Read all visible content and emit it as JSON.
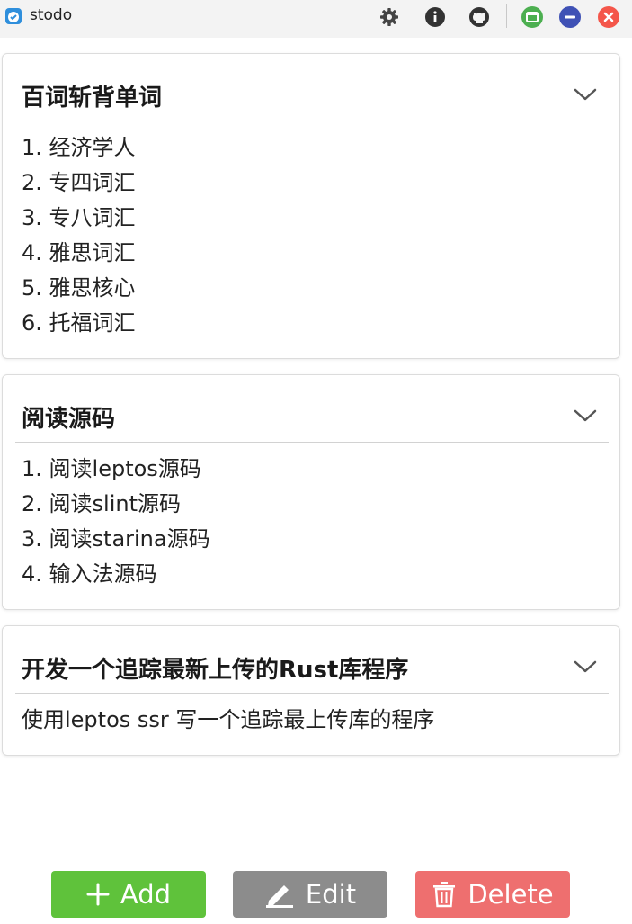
{
  "window": {
    "title": "stodo",
    "controls": [
      "settings-icon",
      "info-icon",
      "github-icon",
      "maximize-icon",
      "minimize-icon",
      "close-icon"
    ],
    "colors": {
      "maximize": "#4caf50",
      "minimize": "#3f51b5",
      "close": "#f4564a"
    }
  },
  "cards": [
    {
      "title": "百词斩背单词",
      "lines": [
        "1. 经济学人",
        "2. 专四词汇",
        "3. 专八词汇",
        "4. 雅思词汇",
        "5. 雅思核心",
        "6. 托福词汇"
      ]
    },
    {
      "title": "阅读源码",
      "lines": [
        "1. 阅读leptos源码",
        "2. 阅读slint源码",
        "3. 阅读starina源码",
        "4. 输入法源码"
      ]
    },
    {
      "title": "开发一个追踪最新上传的Rust库程序",
      "lines": [
        "使用leptos ssr 写一个追踪最上传库的程序"
      ]
    }
  ],
  "buttons": {
    "add": {
      "label": "Add",
      "icon": "plus-icon",
      "color": "#5fc23b"
    },
    "edit": {
      "label": "Edit",
      "icon": "pencil-icon",
      "color": "#8c8c8c"
    },
    "delete": {
      "label": "Delete",
      "icon": "trash-icon",
      "color": "#ee6f6f"
    }
  }
}
